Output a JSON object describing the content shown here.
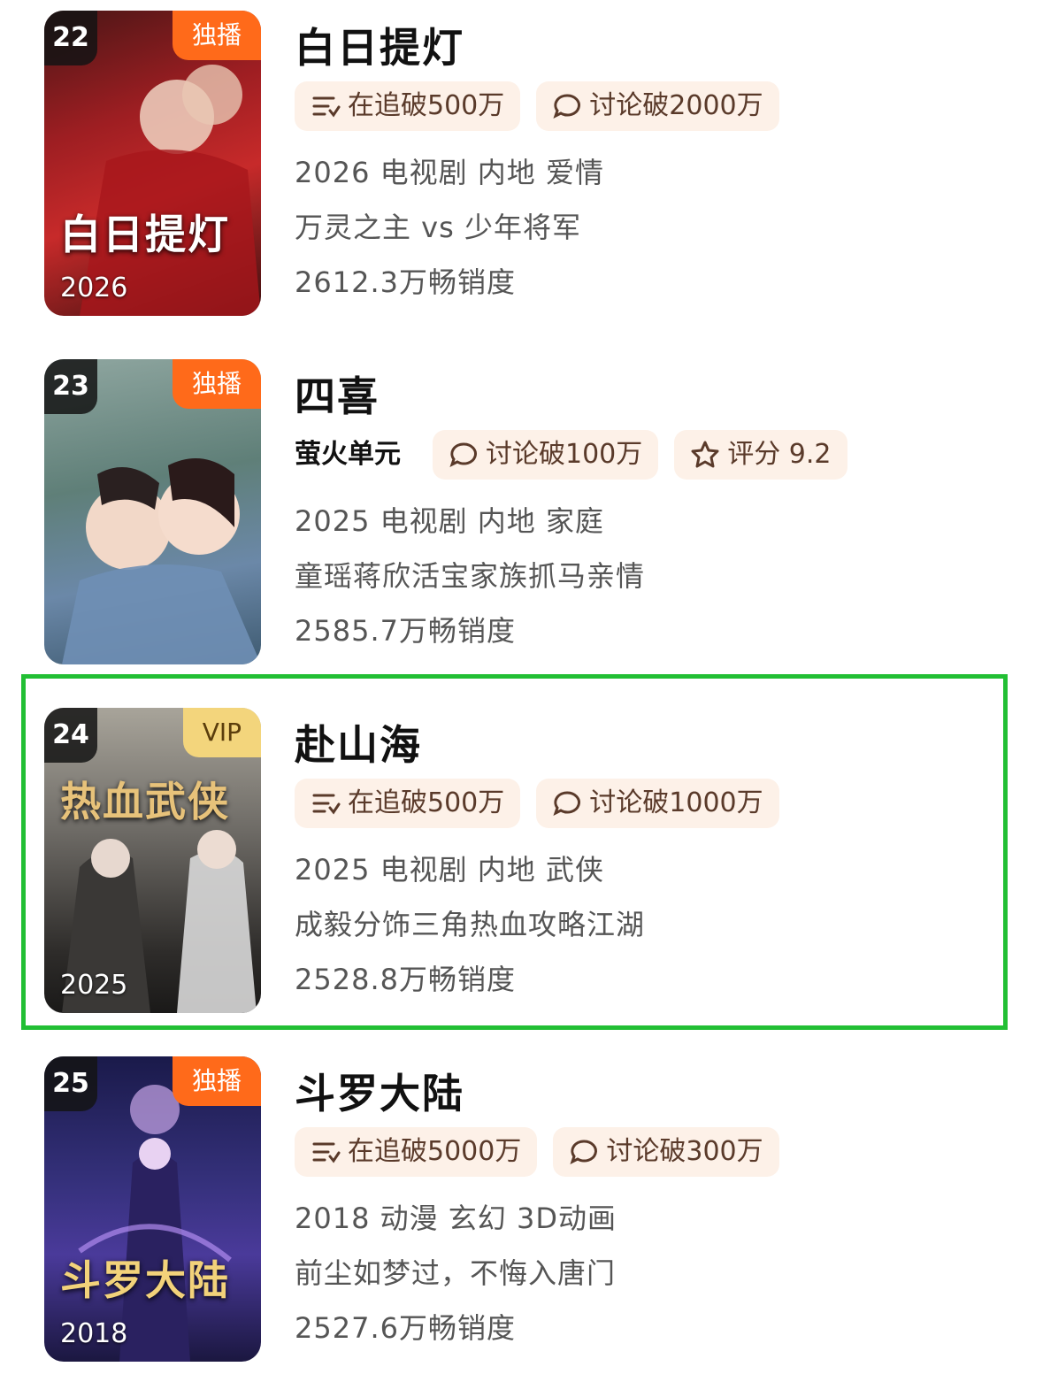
{
  "items": [
    {
      "rank": "22",
      "badge": "独播",
      "badge_color": "#ff6a1a",
      "poster_year": "2026",
      "poster_title": "白日提灯",
      "title": "白日提灯",
      "tags": [
        {
          "icon": "follow-list-icon",
          "label": "在追破500万"
        },
        {
          "icon": "comment-icon",
          "label": "讨论破2000万"
        }
      ],
      "info": "2026 电视剧 内地 爱情",
      "desc": "万灵之主 vs 少年将军",
      "sales": "2612.3万畅销度"
    },
    {
      "rank": "23",
      "badge": "独播",
      "badge_color": "#ff6a1a",
      "poster_year": "",
      "poster_title": "",
      "title": "四喜",
      "tags": [
        {
          "icon": "",
          "label": "萤火单元"
        },
        {
          "icon": "comment-icon",
          "label": "讨论破100万"
        },
        {
          "icon": "star-icon",
          "label": "评分 9.2"
        }
      ],
      "info": "2025 电视剧 内地 家庭",
      "desc": "童瑶蒋欣活宝家族抓马亲情",
      "sales": "2585.7万畅销度"
    },
    {
      "rank": "24",
      "badge": "VIP",
      "badge_color": "#f3d57c",
      "poster_year": "2025",
      "poster_title": "热血武侠",
      "title": "赴山海",
      "tags": [
        {
          "icon": "follow-list-icon",
          "label": "在追破500万"
        },
        {
          "icon": "comment-icon",
          "label": "讨论破1000万"
        }
      ],
      "info": "2025 电视剧 内地 武侠",
      "desc": "成毅分饰三角热血攻略江湖",
      "sales": "2528.8万畅销度"
    },
    {
      "rank": "25",
      "badge": "独播",
      "badge_color": "#ff6a1a",
      "poster_year": "2018",
      "poster_title": "斗罗大陆",
      "title": "斗罗大陆",
      "tags": [
        {
          "icon": "follow-list-icon",
          "label": "在追破5000万"
        },
        {
          "icon": "comment-icon",
          "label": "讨论破300万"
        }
      ],
      "info": "2018 动漫 玄幻 3D动画",
      "desc": "前尘如梦过，不悔入唐门",
      "sales": "2527.6万畅销度"
    }
  ],
  "highlight_color": "#22bf34"
}
